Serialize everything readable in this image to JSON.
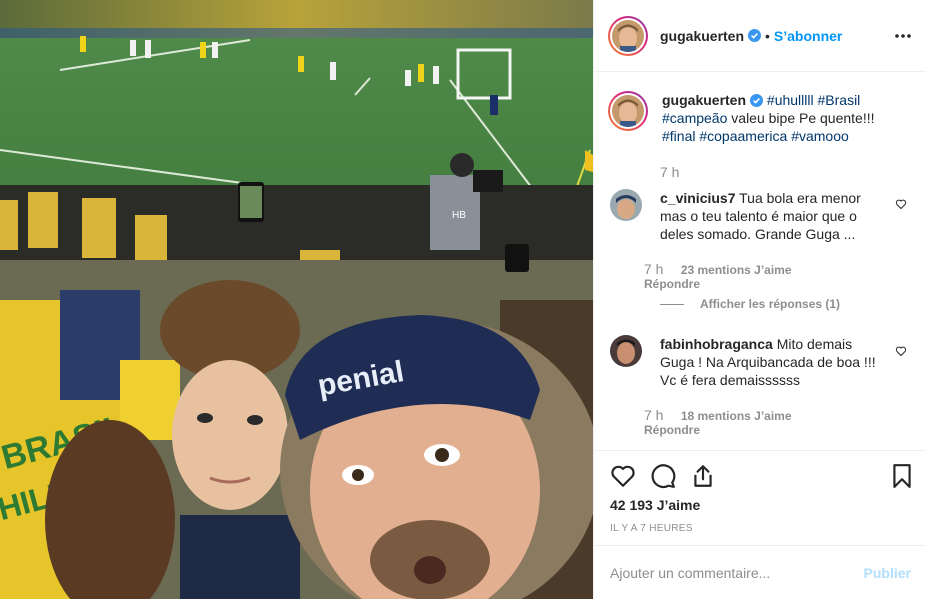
{
  "post": {
    "photo_alt": "Selfie in stadium crowd",
    "photo_text_cap": "penial",
    "photo_text_shirt": "BRASIL",
    "photo_text_shirt2": "HILF",
    "photo_text_vest": "HB"
  },
  "header": {
    "username": "gugakuerten",
    "separator": "•",
    "follow_label": "S’abonner"
  },
  "caption": {
    "username": "gugakuerten",
    "tag1": "#uhulllll",
    "tag2": "#Brasil",
    "tag3": "#campeão",
    "text": "valeu bipe Pe quente!!!",
    "tag4": "#final",
    "tag5": "#copaamerica",
    "tag6": "#vamooo",
    "time": "7 h"
  },
  "comments": [
    {
      "username": "c_vinicius7",
      "text": "Tua bola era menor mas o teu talento é maior que o deles somado. Grande Guga ...",
      "time": "7 h",
      "likes": "23 mentions J’aime",
      "reply": "Répondre",
      "view_replies": "Afficher les réponses (1)"
    },
    {
      "username": "fabinhobraganca",
      "text": "Mito demais Guga ! Na Arquibancada de boa !!! Vc é fera demaissssss",
      "time": "7 h",
      "likes": "18 mentions J’aime",
      "reply": "Répondre"
    }
  ],
  "actions": {
    "like_count": "42 193 J’aime",
    "post_time": "IL Y A 7 HEURES"
  },
  "add_comment": {
    "placeholder": "Ajouter un commentaire...",
    "publish_label": "Publier"
  },
  "colors": {
    "accent": "#0095f6",
    "publish_disabled": "#b2dffc",
    "hashtag": "#00376b",
    "muted": "#8e8e8e"
  }
}
